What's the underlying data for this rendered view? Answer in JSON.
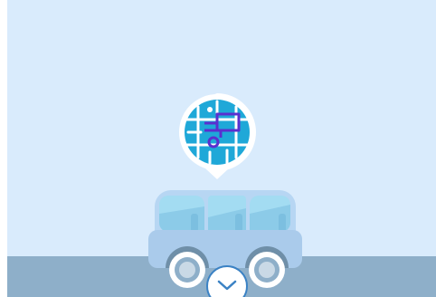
{
  "scene": {
    "sky_color": "#d9ebfc",
    "ground_color": "#8eafc9",
    "van_body_color": "#b7d6f3",
    "van_window_color": "#a3dcf2",
    "pin_color": "#1fa8d8",
    "pin_icon_color": "#5b2fcf",
    "pin_icon": "map-location-icon",
    "vehicle_icon": "van-illustration"
  },
  "scroll_button": {
    "icon": "chevron-down-icon",
    "border_color": "#3b82c4"
  }
}
